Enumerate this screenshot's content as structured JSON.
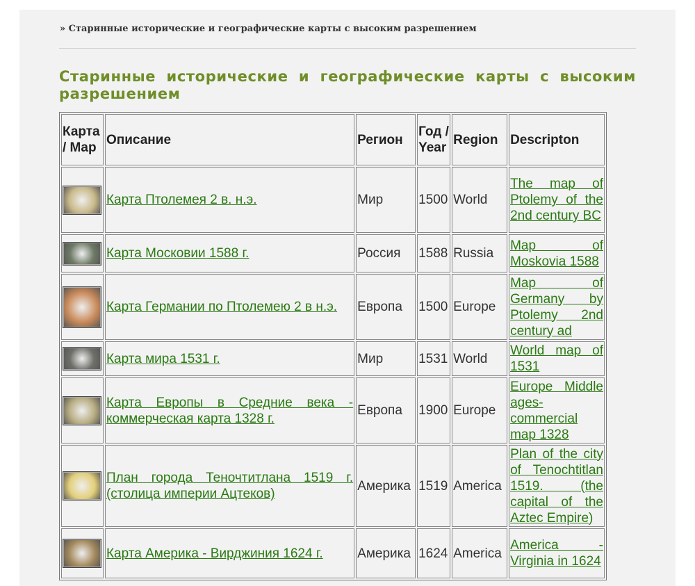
{
  "breadcrumb": "» Старинные исторические и географические карты с высоким разрешением",
  "page_title": "Старинные исторические и географические карты с высоким разрешением",
  "table": {
    "headers": {
      "map": "Карта / Map",
      "description": "Описание",
      "region_ru": "Регион",
      "year": "Год / Year",
      "region_en": "Region",
      "description_en": "Descripton"
    },
    "rows": [
      {
        "title": "Карта Птолемея 2 в. н.э.",
        "region_ru": "Мир",
        "year": "1500",
        "region_en": "World",
        "desc_en": "The map of Ptolemy of the 2nd century BC",
        "thumb_color": "#c9b98a"
      },
      {
        "title": "Карта Московии 1588 г.",
        "region_ru": "Россия",
        "year": "1588",
        "region_en": "Russia",
        "desc_en": "Map of Moskovia 1588",
        "thumb_color": "#6e7a66"
      },
      {
        "title": "Карта Германии по Птолемею 2 в н.э.",
        "region_ru": "Европа",
        "year": "1500",
        "region_en": "Europe",
        "desc_en": "Map of Germany by Ptolemy 2nd century ad",
        "thumb_color": "#c98a5a"
      },
      {
        "title": "Карта мира 1531 г.",
        "region_ru": "Мир",
        "year": "1531",
        "region_en": "World",
        "desc_en": "World map of 1531",
        "thumb_color": "#6f6f6a"
      },
      {
        "title": "Карта Европы в Средние века - коммерческая карта 1328 г.",
        "region_ru": "Европа",
        "year": "1900",
        "region_en": "Europe",
        "desc_en": "Europe Middle ages- commercial map 1328",
        "thumb_color": "#b8ad82"
      },
      {
        "title": "План города Теночтитлана 1519 г. (столица империи Ацтеков)",
        "region_ru": "Америка",
        "year": "1519",
        "region_en": "America",
        "desc_en": "Plan of the city of Tenochtitlan 1519. (the capital of the Aztec Empire)",
        "thumb_color": "#e3cf7a"
      },
      {
        "title": "Карта Америка - Вирджиния 1624 г.",
        "region_ru": "Америка",
        "year": "1624",
        "region_en": "America",
        "desc_en": "America - Virginia in 1624",
        "thumb_color": "#a58a5e"
      }
    ]
  }
}
